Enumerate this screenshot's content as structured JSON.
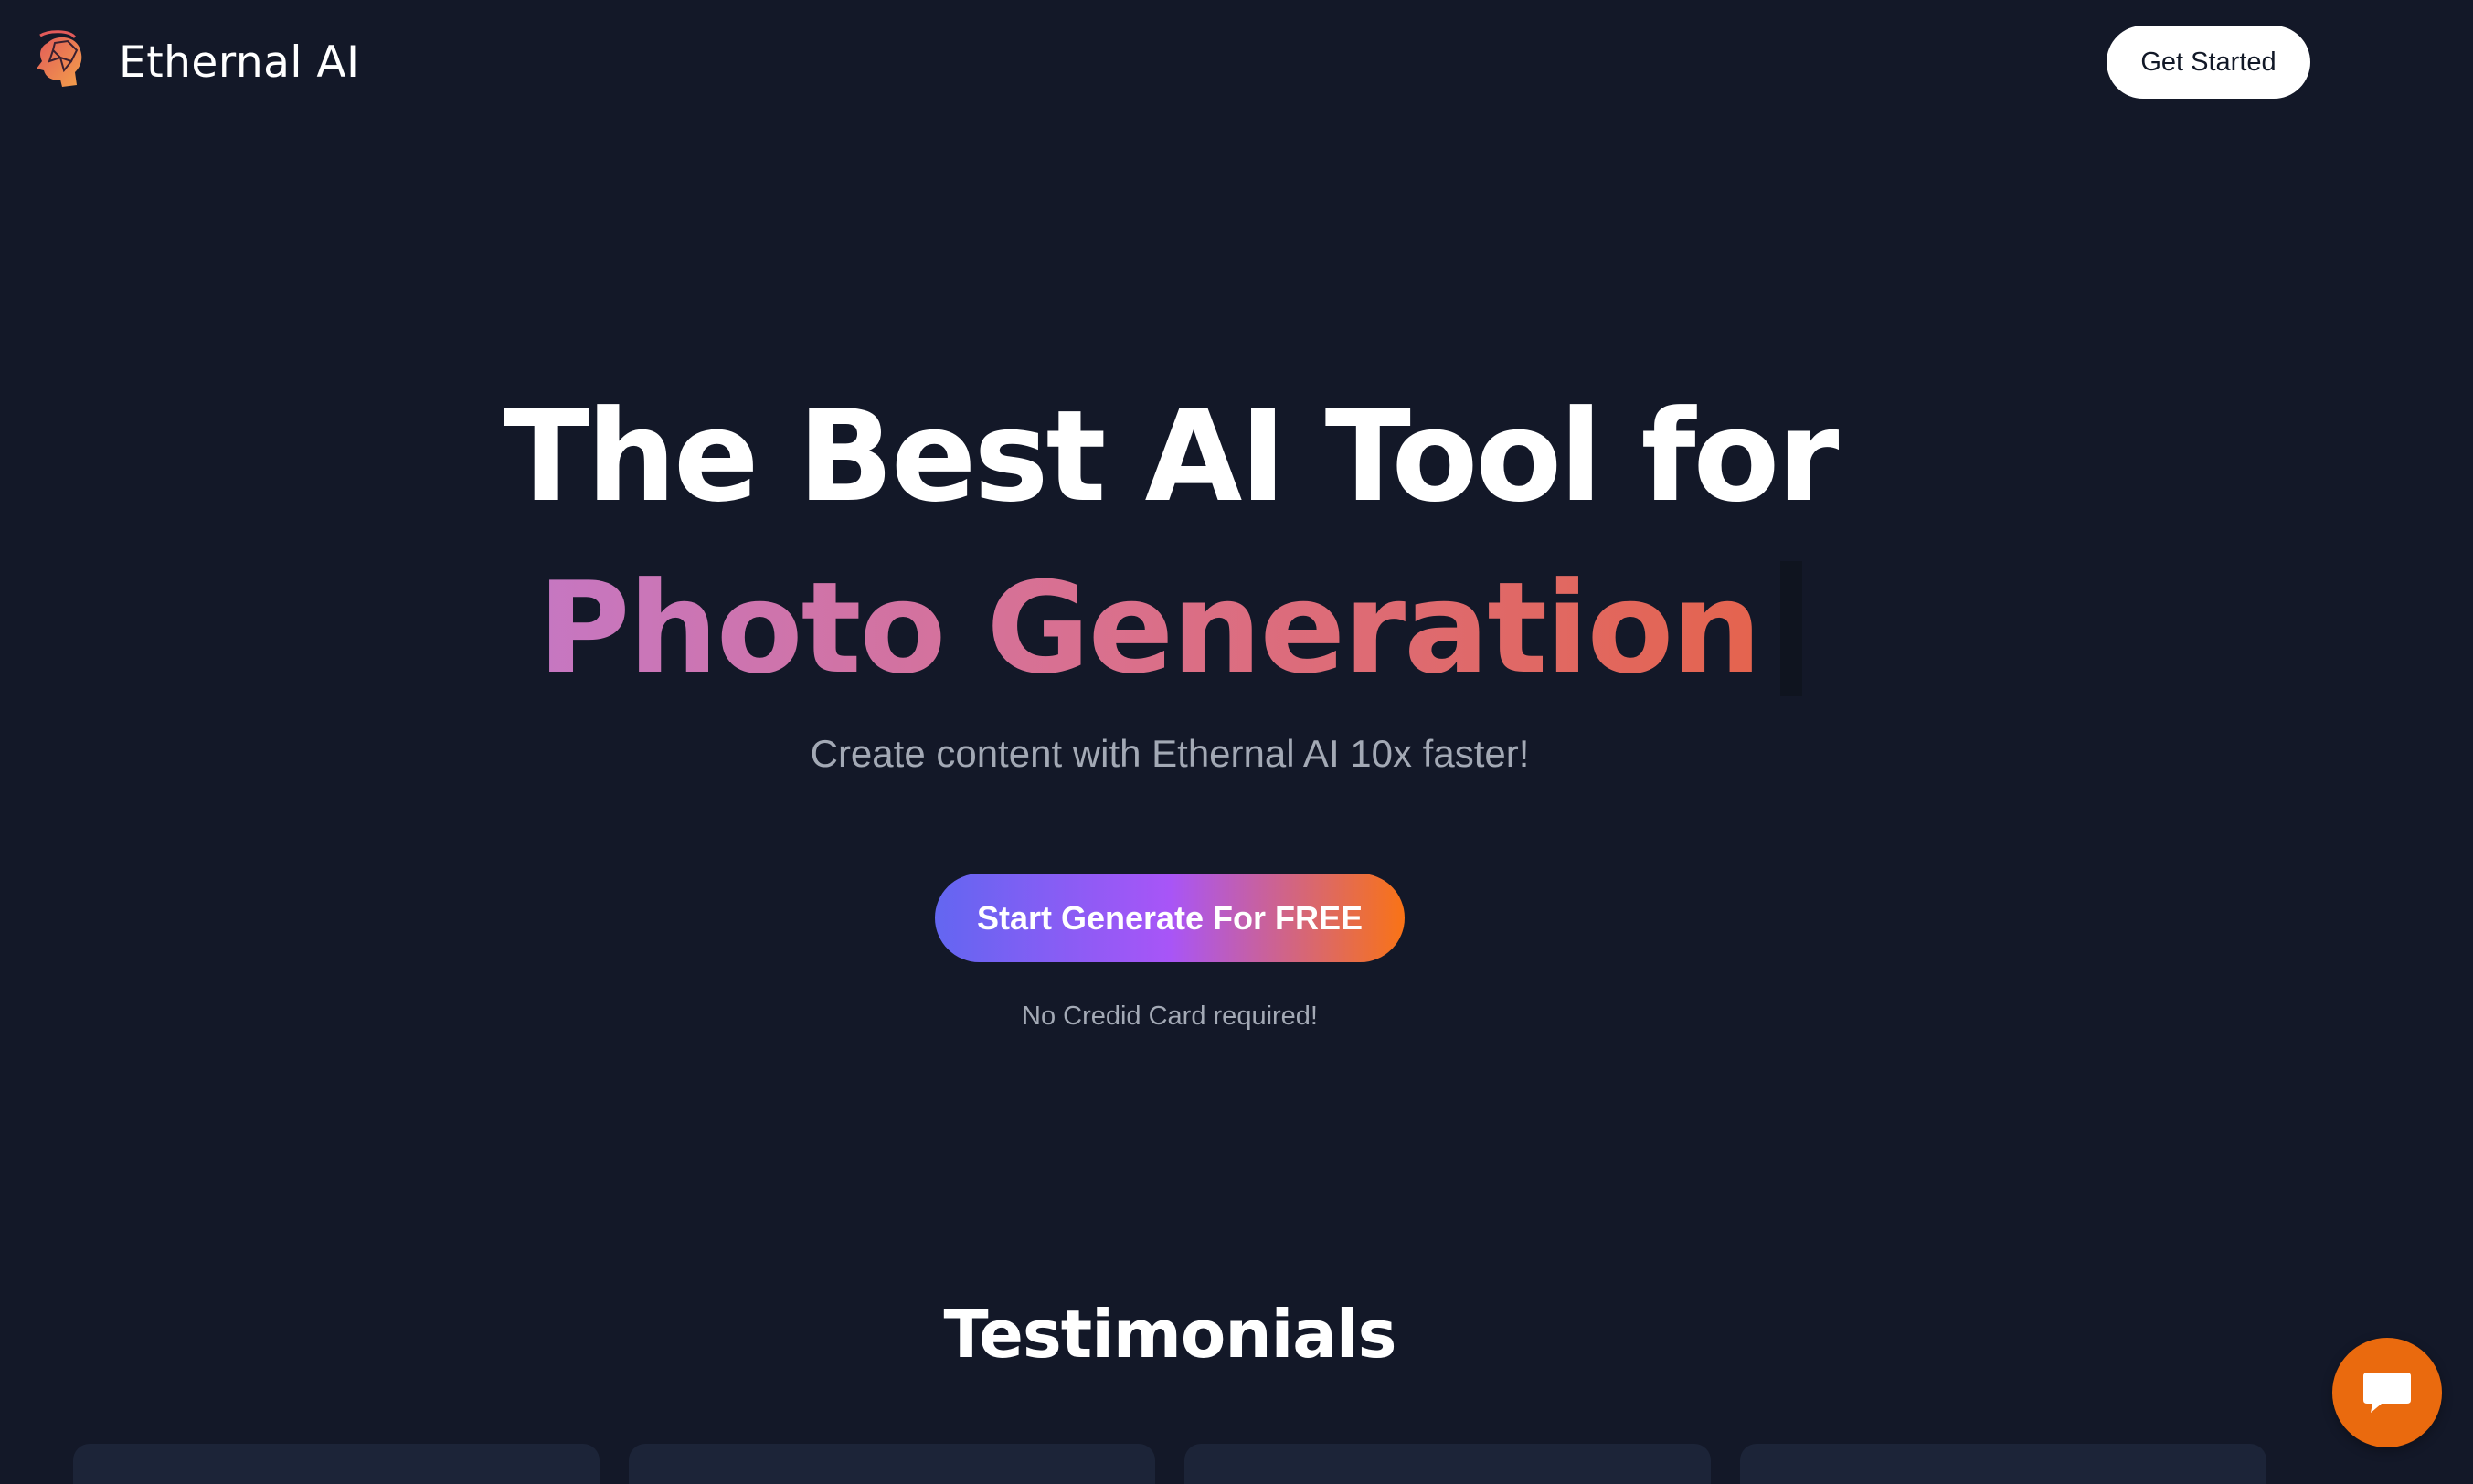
{
  "header": {
    "brand_name": "Ethernal AI",
    "logo_icon": "brain-head-logo-icon",
    "get_started_label": "Get Started"
  },
  "hero": {
    "title_line1": "The Best AI Tool for",
    "title_line2": "Photo Generation",
    "subtitle": "Create content with Ethernal AI 10x faster!",
    "cta_label": "Start Generate For FREE",
    "cta_note": "No Credid Card required!"
  },
  "testimonials": {
    "title": "Testimonials"
  },
  "chat": {
    "icon": "chat-bubble-icon"
  },
  "colors": {
    "background": "#131828",
    "gradient_text_start": "#c677c2",
    "gradient_text_end": "#e4644e",
    "cta_gradient_start": "#6366f1",
    "cta_gradient_mid": "#a855f7",
    "cta_gradient_end": "#f97316",
    "chat_button": "#ea6a0e",
    "card_background": "#1c2438"
  }
}
